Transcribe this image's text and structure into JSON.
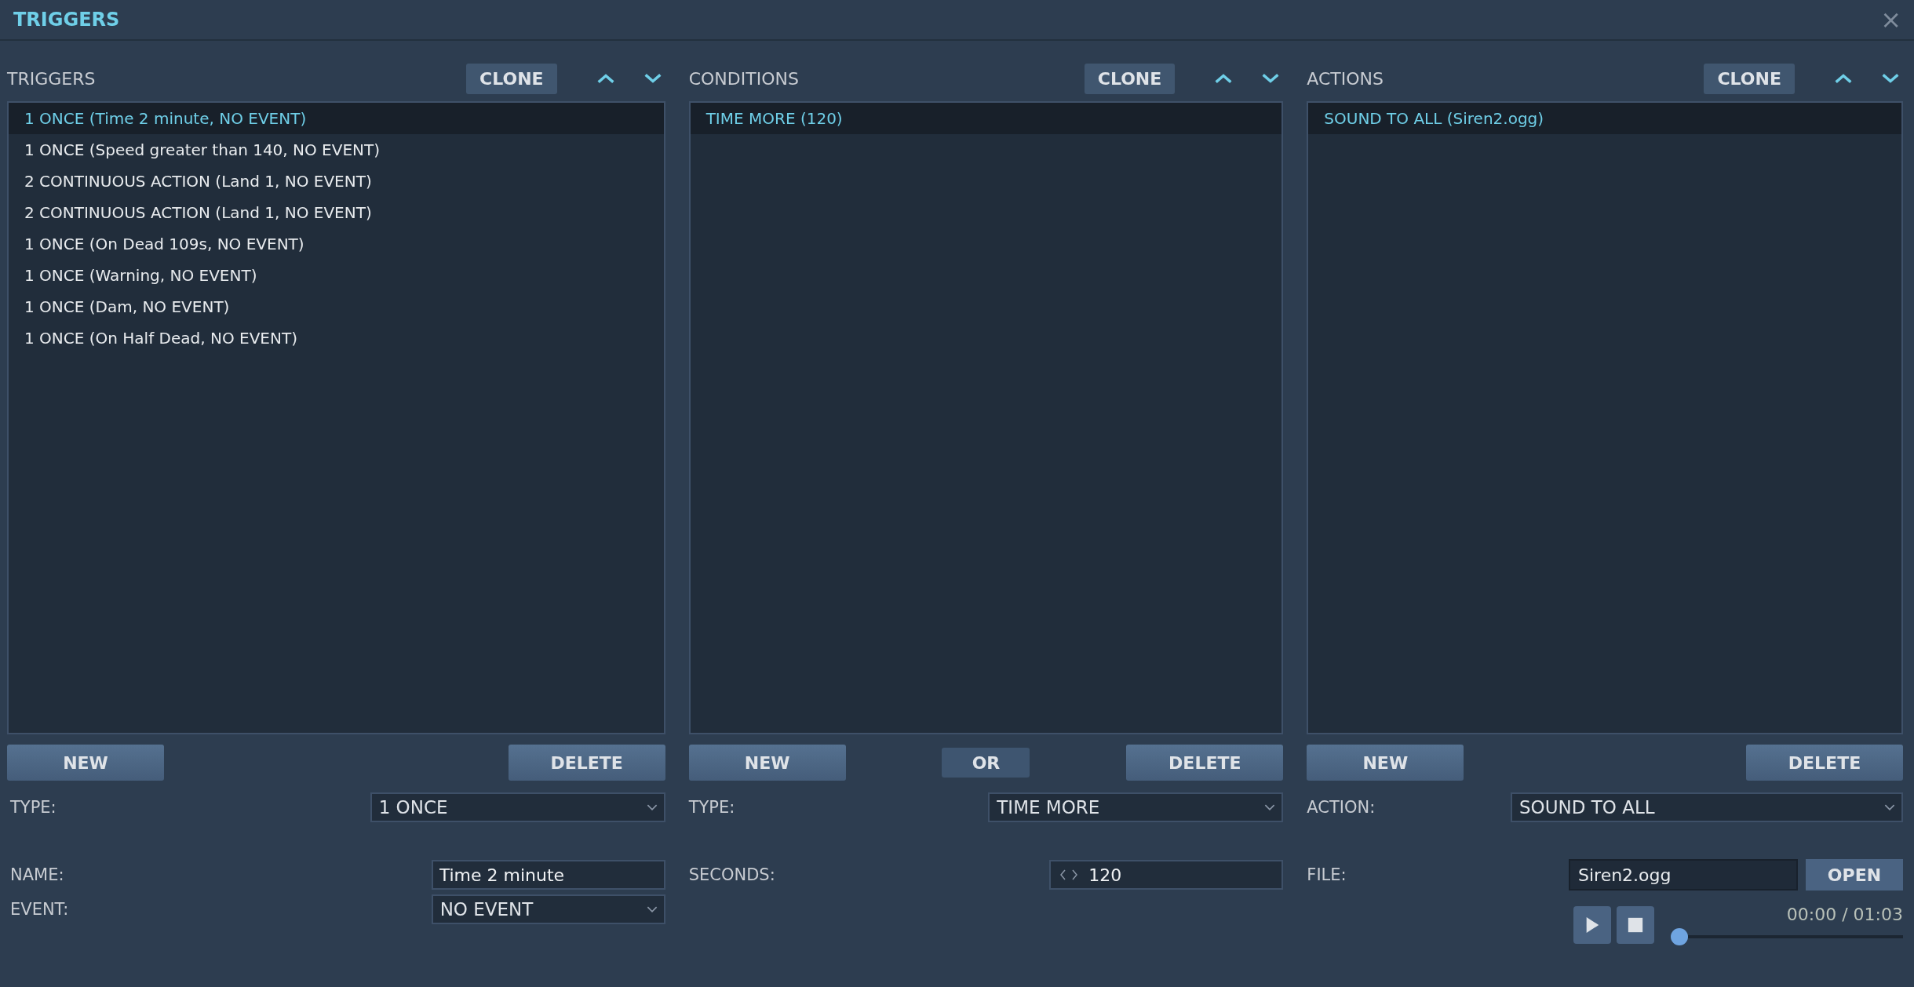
{
  "window": {
    "title": "TRIGGERS",
    "close": "×"
  },
  "panels": [
    {
      "title": "TRIGGERS",
      "clone": "CLONE",
      "items": [
        {
          "label": "1 ONCE (Time 2 minute, NO EVENT)",
          "selected": true
        },
        {
          "label": "1 ONCE (Speed greater than 140, NO EVENT)",
          "selected": false
        },
        {
          "label": "2 CONTINUOUS ACTION (Land 1, NO EVENT)",
          "selected": false
        },
        {
          "label": "2 CONTINUOUS ACTION (Land 1, NO EVENT)",
          "selected": false
        },
        {
          "label": "1 ONCE (On Dead 109s, NO EVENT)",
          "selected": false
        },
        {
          "label": "1 ONCE (Warning, NO EVENT)",
          "selected": false
        },
        {
          "label": "1 ONCE (Dam, NO EVENT)",
          "selected": false
        },
        {
          "label": "1 ONCE (On Half Dead, NO EVENT)",
          "selected": false
        }
      ],
      "buttons": [
        {
          "label": "NEW",
          "kind": "large"
        },
        {
          "label": "DELETE",
          "kind": "large"
        }
      ],
      "fields": [
        {
          "kind": "dropdown",
          "label": "TYPE:",
          "value": "1 ONCE"
        },
        {
          "kind": "text",
          "label": "NAME:",
          "value": "Time 2 minute"
        },
        {
          "kind": "dropdown",
          "label": "EVENT:",
          "value": "NO EVENT"
        }
      ]
    },
    {
      "title": "CONDITIONS",
      "clone": "CLONE",
      "items": [
        {
          "label": "TIME MORE (120)",
          "selected": true
        }
      ],
      "buttons": [
        {
          "label": "NEW",
          "kind": "large"
        },
        {
          "label": "OR",
          "kind": "small"
        },
        {
          "label": "DELETE",
          "kind": "large"
        }
      ],
      "fields": [
        {
          "kind": "dropdown",
          "label": "TYPE:",
          "value": "TIME MORE"
        },
        {
          "kind": "spinner",
          "label": "SECONDS:",
          "value": "120"
        }
      ]
    },
    {
      "title": "ACTIONS",
      "clone": "CLONE",
      "items": [
        {
          "label": "SOUND TO ALL (Siren2.ogg)",
          "selected": true
        }
      ],
      "buttons": [
        {
          "label": "NEW",
          "kind": "large"
        },
        {
          "label": "DELETE",
          "kind": "large"
        }
      ],
      "fields": [
        {
          "kind": "dropdown",
          "label": "ACTION:",
          "value": "SOUND TO ALL"
        },
        {
          "kind": "file",
          "label": "FILE:",
          "value": "Siren2.ogg",
          "button": "OPEN"
        },
        {
          "kind": "player",
          "time": "00:00 / 01:03",
          "level": 0
        }
      ]
    }
  ]
}
